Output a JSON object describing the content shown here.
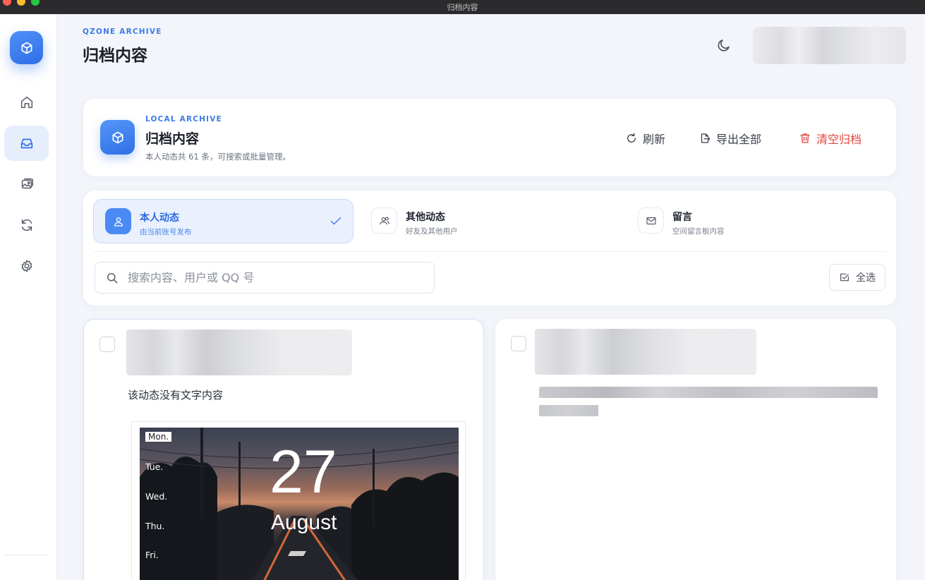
{
  "window": {
    "title": "归档内容"
  },
  "sidebar": {
    "items": [
      {
        "name": "home",
        "icon": "home-icon"
      },
      {
        "name": "archive",
        "icon": "inbox-icon",
        "active": true
      },
      {
        "name": "gallery",
        "icon": "image-icon"
      },
      {
        "name": "sync",
        "icon": "refresh-icon"
      },
      {
        "name": "settings",
        "icon": "gear-icon"
      }
    ]
  },
  "header": {
    "eyebrow": "QZONE ARCHIVE",
    "title": "归档内容"
  },
  "archive": {
    "eyebrow": "LOCAL ARCHIVE",
    "title": "归档内容",
    "description": "本人动态共 61 条，可搜索或批量管理。",
    "actions": {
      "refresh": "刷新",
      "export_all": "导出全部",
      "clear": "清空归档"
    }
  },
  "tabs": [
    {
      "title": "本人动态",
      "subtitle": "由当前账号发布",
      "active": true
    },
    {
      "title": "其他动态",
      "subtitle": "好友及其他用户",
      "active": false
    },
    {
      "title": "留言",
      "subtitle": "空间留言板内容",
      "active": false
    }
  ],
  "search": {
    "placeholder": "搜索内容、用户或 QQ 号",
    "value": ""
  },
  "select_all": "全选",
  "posts": [
    {
      "text": "该动态没有文字内容",
      "image": {
        "days": [
          "Mon.",
          "Tue.",
          "Wed.",
          "Thu.",
          "Fri."
        ],
        "date": "27",
        "month": "August"
      }
    },
    {
      "text_redacted": true
    }
  ],
  "colors": {
    "accent": "#3d7be8",
    "danger": "#e0453a",
    "active_tab_bg": "#eaf1fd"
  }
}
